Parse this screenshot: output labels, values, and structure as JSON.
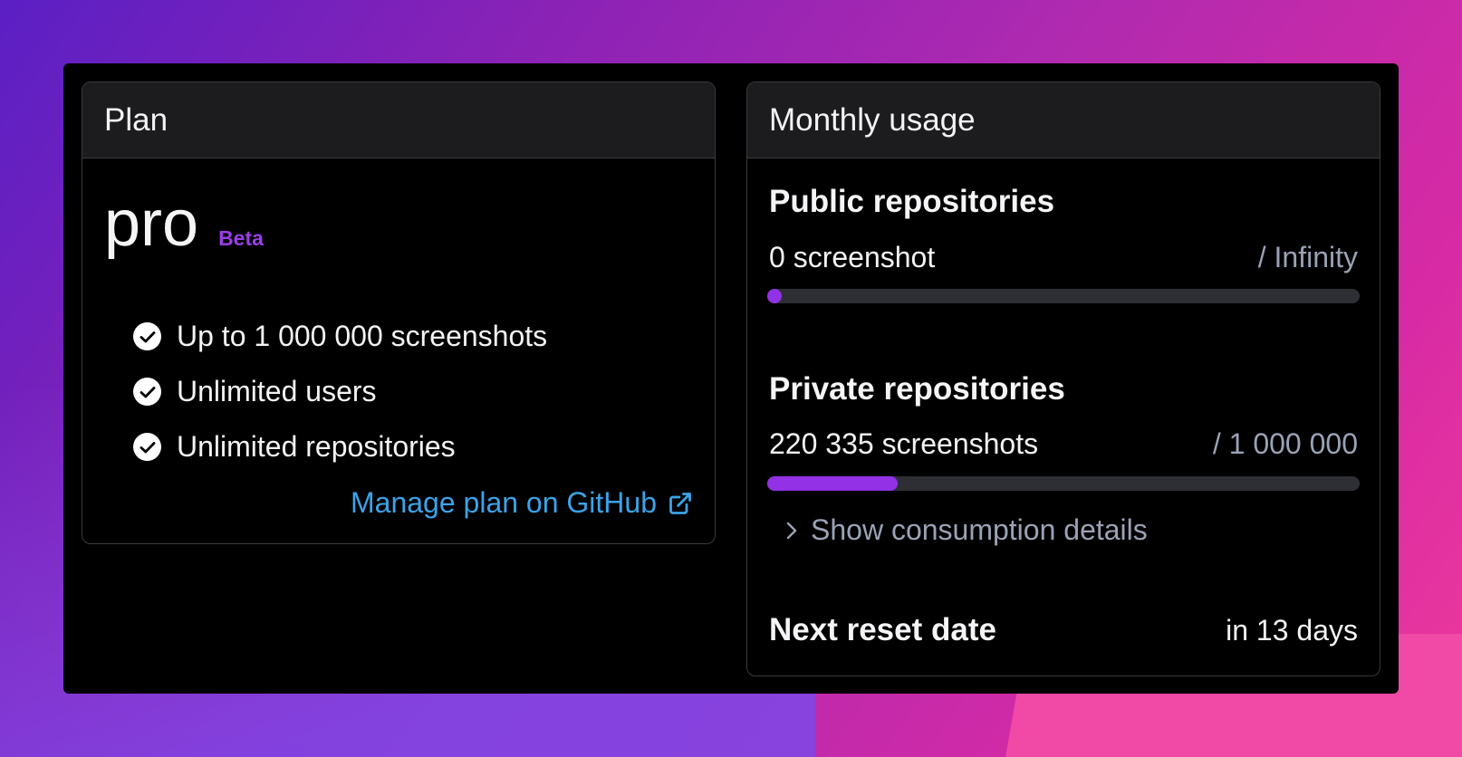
{
  "plan_card": {
    "header": "Plan",
    "plan_name": "pro",
    "badge": "Beta",
    "features": [
      "Up to 1 000 000 screenshots",
      "Unlimited users",
      "Unlimited repositories"
    ],
    "manage_link": "Manage plan on GitHub"
  },
  "usage_card": {
    "header": "Monthly usage",
    "public": {
      "title": "Public repositories",
      "count": "0 screenshot",
      "limit": "/ Infinity",
      "progress": 0
    },
    "private": {
      "title": "Private repositories",
      "count": "220 335 screenshots",
      "limit": "/ 1 000 000",
      "progress": 0.2203
    },
    "details_label": "Show consumption details",
    "reset": {
      "label": "Next reset date",
      "value": "in 13 days"
    }
  },
  "colors": {
    "accent_purple": "#9231e6",
    "link_blue": "#3ba3e8",
    "muted_text": "#9aa2b5",
    "bar_track": "#2e2f35"
  },
  "icons": {
    "check": "check-circle-icon",
    "external": "external-link-icon",
    "chevron": "chevron-right-icon"
  }
}
